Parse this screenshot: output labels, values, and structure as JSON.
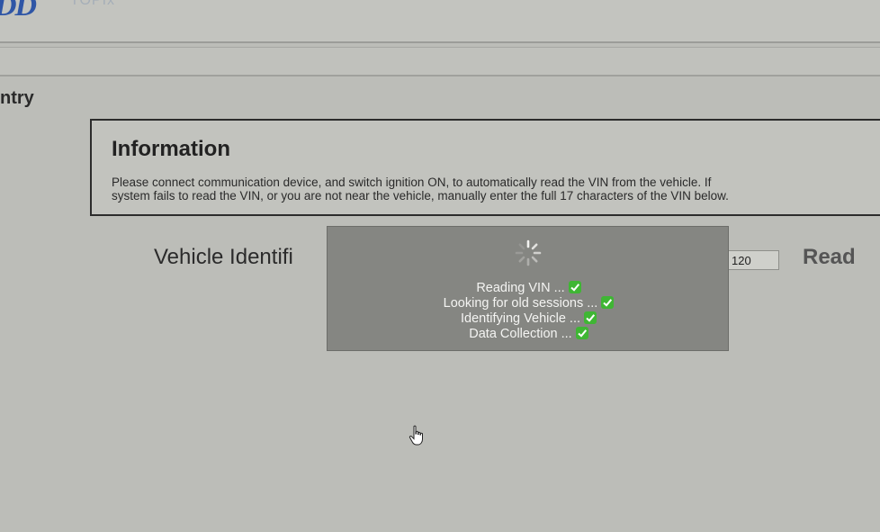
{
  "header": {
    "logo": "DD",
    "logo_sub": "TOPIx"
  },
  "section": {
    "title": "ntry"
  },
  "information": {
    "title": "Information",
    "line1": "Please connect communication device, and switch ignition ON, to automatically read the VIN from the vehicle. If",
    "line2": "system fails to read the VIN, or you are not near the vehicle, manually enter the full 17 characters of the VIN below."
  },
  "vin": {
    "label": "Vehicle Identifi",
    "value": "120",
    "read_label": "Read"
  },
  "overlay": {
    "steps": [
      {
        "label": "Reading VIN ...",
        "done": true
      },
      {
        "label": "Looking for old sessions ...",
        "done": true
      },
      {
        "label": "Identifying Vehicle ...",
        "done": true
      },
      {
        "label": "Data Collection ...",
        "done": true
      }
    ]
  },
  "colors": {
    "logo": "#2f56a6",
    "check": "#3fb634",
    "overlay_bg": "#858682"
  },
  "icons": {
    "spinner": "loading-spinner-icon",
    "check": "checkmark-icon",
    "cursor": "hand-pointer-icon"
  }
}
